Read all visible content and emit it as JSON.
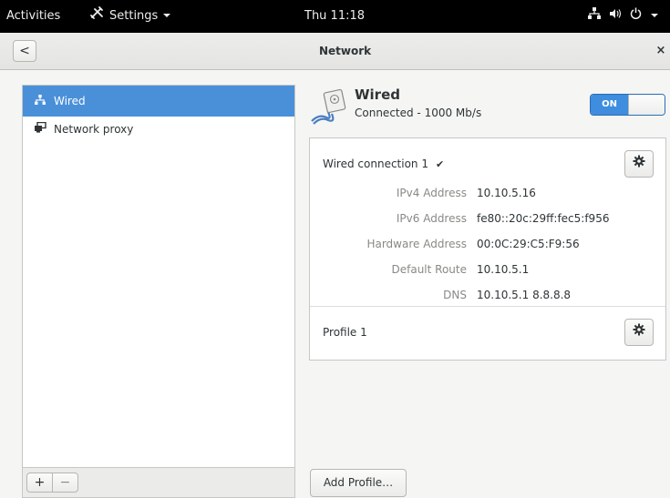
{
  "topbar": {
    "activities": "Activities",
    "app_menu": "Settings",
    "clock": "Thu 11:18",
    "icons": [
      "network-wired-icon",
      "volume-icon",
      "power-icon",
      "chevron-down-icon"
    ]
  },
  "header": {
    "back": "<",
    "title": "Network",
    "close": "×"
  },
  "sidebar": {
    "items": [
      {
        "label": "Wired",
        "icon": "network-wired-icon",
        "selected": true
      },
      {
        "label": "Network proxy",
        "icon": "network-proxy-icon",
        "selected": false
      }
    ],
    "add": "+",
    "remove": "−"
  },
  "device": {
    "name": "Wired",
    "status": "Connected - 1000 Mb/s",
    "switch_label": "ON",
    "switch_on": true
  },
  "connection": {
    "name": "Wired connection 1",
    "check": "✔",
    "details": [
      {
        "label": "IPv4 Address",
        "value": "10.10.5.16"
      },
      {
        "label": "IPv6 Address",
        "value": "fe80::20c:29ff:fec5:f956"
      },
      {
        "label": "Hardware Address",
        "value": "00:0C:29:C5:F9:56"
      },
      {
        "label": "Default Route",
        "value": "10.10.5.1"
      },
      {
        "label": "DNS",
        "value": "10.10.5.1 8.8.8.8"
      }
    ]
  },
  "profile": {
    "name": "Profile 1"
  },
  "buttons": {
    "add_profile": "Add Profile…"
  },
  "colors": {
    "accent": "#4a90d9",
    "topbar_bg": "#000000",
    "switch_on": "#3e8dde"
  }
}
